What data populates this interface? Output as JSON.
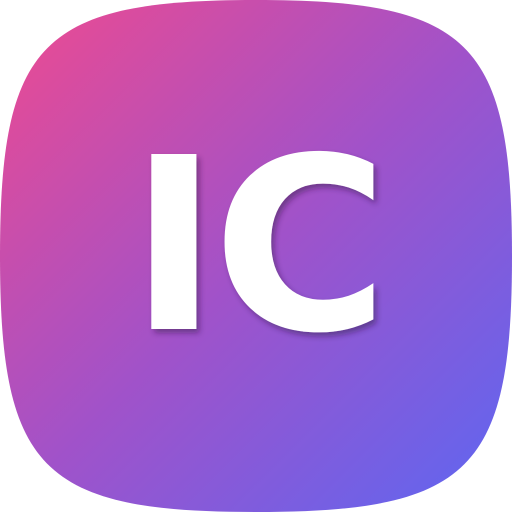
{
  "icon": {
    "name": "app-icon",
    "monogram": "IC",
    "colors": {
      "gradient_start": "#ef4a8f",
      "gradient_mid": "#a152c9",
      "gradient_end": "#5c67f2",
      "letter": "#ffffff"
    }
  }
}
